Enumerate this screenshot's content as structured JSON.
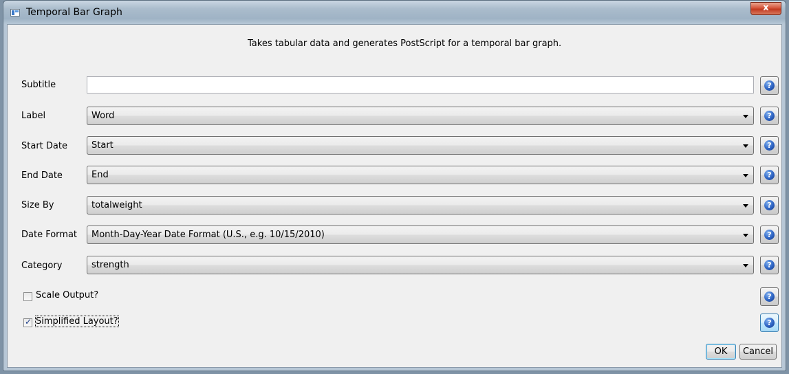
{
  "window": {
    "title": "Temporal Bar Graph",
    "close_label": "x"
  },
  "description": "Takes tabular data and generates PostScript for a temporal bar graph.",
  "fields": {
    "subtitle": {
      "label": "Subtitle",
      "value": ""
    },
    "label": {
      "label": "Label",
      "value": "Word"
    },
    "start_date": {
      "label": "Start Date",
      "value": "Start"
    },
    "end_date": {
      "label": "End Date",
      "value": "End"
    },
    "size_by": {
      "label": "Size By",
      "value": "totalweight"
    },
    "date_format": {
      "label": "Date Format",
      "value": "Month-Day-Year Date Format (U.S., e.g. 10/15/2010)"
    },
    "category": {
      "label": "Category",
      "value": "strength"
    }
  },
  "checkboxes": {
    "scale_output": {
      "label": "Scale Output?",
      "checked": false
    },
    "simplified_layout": {
      "label": "Simplified Layout?",
      "checked": true
    }
  },
  "buttons": {
    "ok": "OK",
    "cancel": "Cancel",
    "help_glyph": "?"
  },
  "colors": {
    "help_icon": "#2d63c2",
    "close_button": "#c13a20",
    "default_button_border": "#3c7fb1"
  }
}
